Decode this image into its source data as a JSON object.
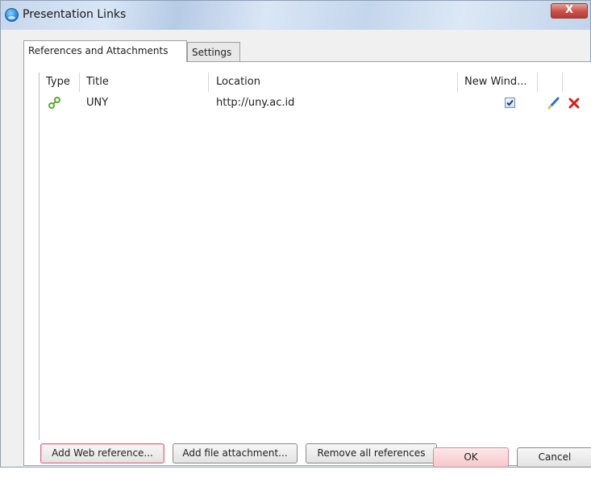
{
  "window": {
    "title": "Presentation Links",
    "close_glyph": "X"
  },
  "tabs": [
    {
      "label": "References and Attachments",
      "active": true
    },
    {
      "label": "Settings",
      "active": false
    }
  ],
  "table": {
    "columns": [
      "Type",
      "Title",
      "Location",
      "New Wind..."
    ],
    "rows": [
      {
        "type_icon": "link-icon",
        "title": "UNY",
        "location": "http://uny.ac.id",
        "new_window": true,
        "edit_icon": "pencil-icon",
        "delete_icon": "delete-x-icon"
      }
    ]
  },
  "buttons": {
    "add_web": "Add Web reference...",
    "add_file": "Add file attachment...",
    "remove_all": "Remove all references",
    "ok": "OK",
    "cancel": "Cancel"
  },
  "colors": {
    "link_icon": "#5aa832",
    "pencil": "#2f6fd4",
    "delete": "#d81e1e"
  }
}
